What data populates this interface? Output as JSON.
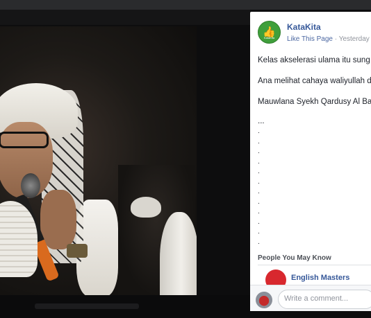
{
  "panel": {
    "page_name": "KataKita",
    "avatar_icon": "thumbs-up-icon",
    "avatar_text": "KataKita",
    "like_link": "Like This Page",
    "separator": "·",
    "timestamp": "Yesterday",
    "post_lines": [
      "Kelas akselerasi ulama itu sung",
      "Ana melihat cahaya waliyullah d",
      "Mauwlana Syekh Qardusy Al Ba"
    ],
    "ellipsis": "...",
    "dots": [
      ".",
      ".",
      ".",
      ".",
      ".",
      ".",
      ".",
      ".",
      ".",
      ".",
      ".",
      ".",
      "."
    ],
    "pymk_title": "People You May Know",
    "pymk_name": "English Masters",
    "comment_placeholder": "Write a comment..."
  },
  "colors": {
    "link_blue": "#365899",
    "avatar_green": "#3f9f3b",
    "background_dark": "#0d0d0e"
  }
}
